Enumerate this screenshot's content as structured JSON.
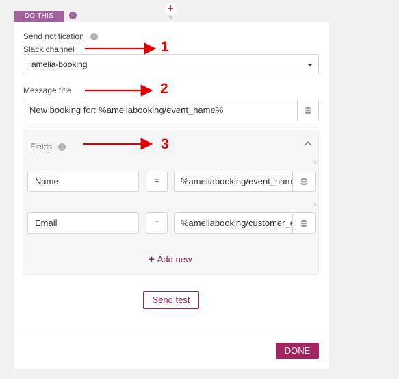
{
  "connector": {
    "plus": "+",
    "arrow": "▼"
  },
  "section_tab": {
    "label": "DO THIS",
    "info": "i"
  },
  "action": {
    "label": "Send notification",
    "info": "i"
  },
  "slack_channel": {
    "label": "Slack channel",
    "value": "amelia-booking"
  },
  "message_title": {
    "label": "Message title",
    "value": "New booking for: %ameliabooking/event_name%"
  },
  "fields": {
    "label": "Fields",
    "info": "i",
    "rows": [
      {
        "name": "Name",
        "operator": "=",
        "value": "%ameliabooking/event_name%"
      },
      {
        "name": "Email",
        "operator": "=",
        "value": "%ameliabooking/customer_email%"
      }
    ],
    "remove": "×",
    "add_new": "Add new",
    "add_plus": "+"
  },
  "buttons": {
    "send_test": "Send test",
    "done": "DONE"
  },
  "annotations": {
    "one": "1",
    "two": "2",
    "three": "3",
    "color": "#e00000"
  },
  "colors": {
    "accent": "#a0245f",
    "tab": "#a361a0"
  }
}
